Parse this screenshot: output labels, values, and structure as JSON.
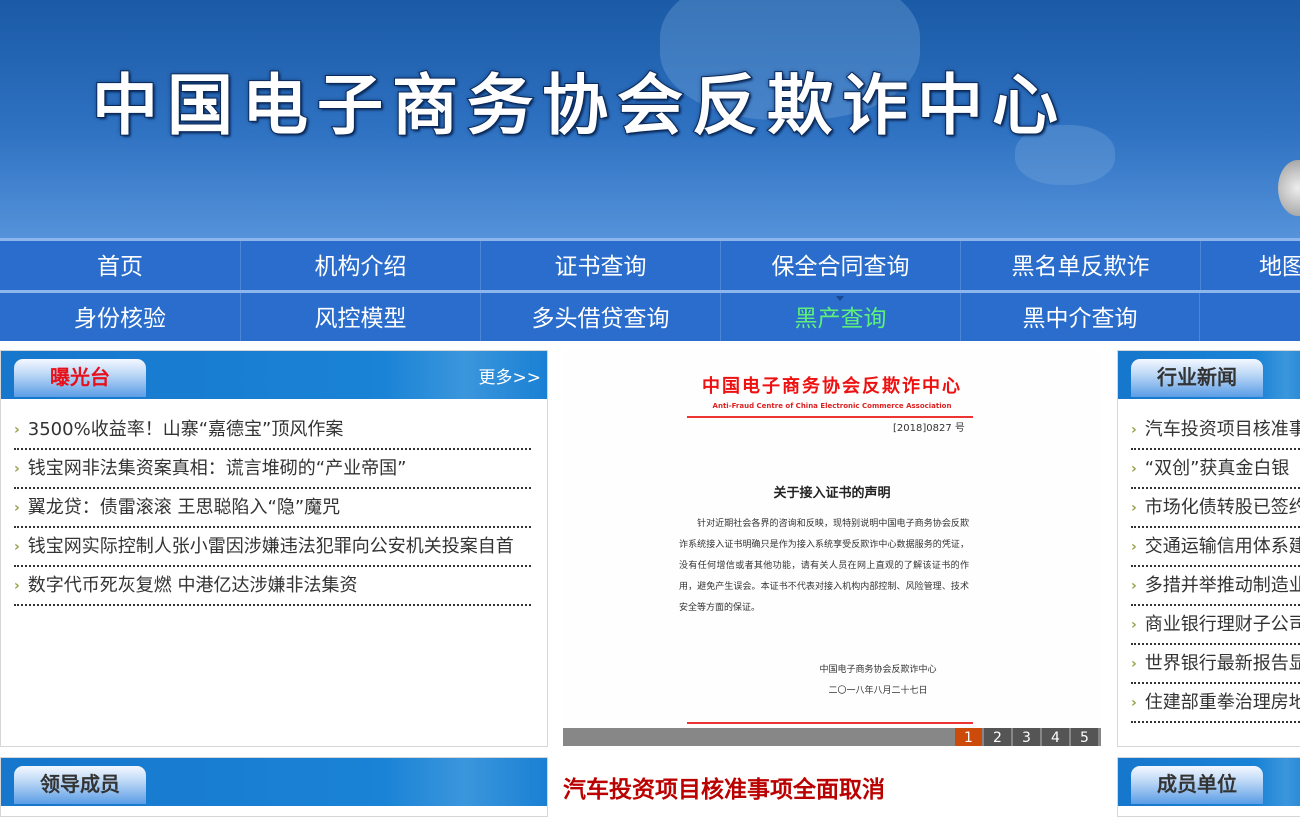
{
  "site_title": "中国电子商务协会反欺诈中心",
  "nav": {
    "row1": [
      "首页",
      "机构介绍",
      "证书查询",
      "保全合同查询",
      "黑名单反欺诈",
      "地图"
    ],
    "row2": [
      "身份核验",
      "风控模型",
      "多头借贷查询",
      "黑产查询",
      "黑中介查询"
    ],
    "active": "黑产查询"
  },
  "exposure": {
    "title": "曝光台",
    "more": "更多>>",
    "items": [
      "3500%收益率！山寨“嘉德宝”顶风作案",
      "钱宝网非法集资案真相：谎言堆砌的“产业帝国”",
      "翼龙贷：债雷滚滚  王思聪陷入“隐”魔咒",
      "钱宝网实际控制人张小雷因涉嫌违法犯罪向公安机关投案自首",
      "数字代币死灰复燃 中港亿达涉嫌非法集资"
    ]
  },
  "slide": {
    "title": "中国电子商务协会反欺诈中心",
    "subtitle": "Anti-Fraud Centre of China Electronic Commerce Association",
    "doc_no": "[2018]0827 号",
    "heading": "关于接入证书的声明",
    "body": "针对近期社会各界的咨询和反映，现特别说明中国电子商务协会反欺诈系统接入证书明确只是作为接入系统享受反欺诈中心数据服务的凭证，没有任何增信或者其他功能，请有关人员在网上直观的了解该证书的作用，避免产生误会。本证书不代表对接入机构内部控制、风险管理、技术安全等方面的保证。",
    "sign_org": "中国电子商务协会反欺诈中心",
    "sign_date": "二〇一八年八月二十七日",
    "pages": [
      "1",
      "2",
      "3",
      "4",
      "5"
    ],
    "current_page": "1"
  },
  "industry": {
    "title": "行业新闻",
    "items": [
      "汽车投资项目核准事",
      "“双创”获真金白银",
      "市场化债转股已签约",
      "交通运输信用体系建",
      "多措并举推动制造业",
      "商业银行理财子公司",
      "世界银行最新报告显",
      "住建部重拳治理房地"
    ]
  },
  "leaders": {
    "title": "领导成员"
  },
  "headline": "汽车投资项目核准事项全面取消",
  "members": {
    "title": "成员单位"
  },
  "colors": {
    "nav": "#2a6dcc",
    "active_nav": "#5ef07a",
    "panel_head": "#1677cc",
    "pager_active": "#cc4a0a",
    "headline": "#bb0000"
  }
}
